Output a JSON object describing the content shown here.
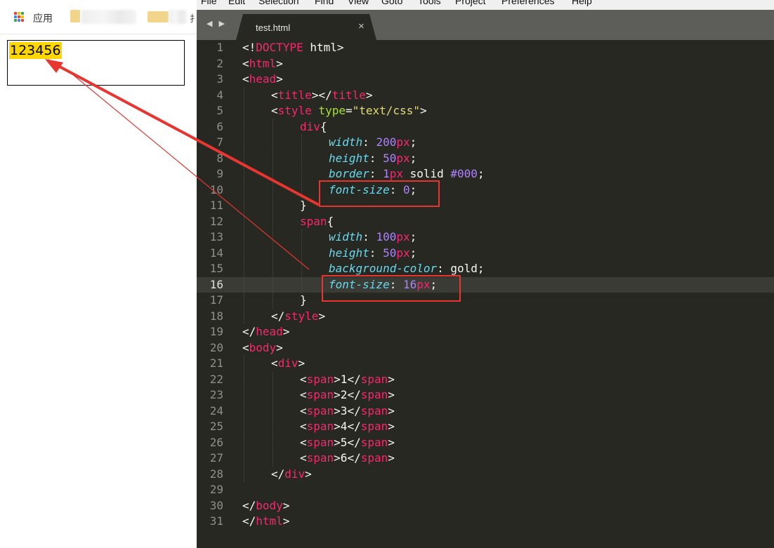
{
  "browser": {
    "bookmarks": {
      "apps_label": "应用",
      "more_glyph": "扌"
    },
    "demo_output": "123456"
  },
  "editor": {
    "menu": [
      "File",
      "Edit",
      "Selection",
      "Find",
      "View",
      "Goto",
      "Tools",
      "Project",
      "Preferences",
      "Help"
    ],
    "tab": {
      "title": "test.html",
      "close_glyph": "×",
      "nav_glyph": "◀ ▶"
    },
    "current_line": 16,
    "lines": [
      {
        "n": "1",
        "indent": 0,
        "tokens": [
          [
            "pun",
            "<!"
          ],
          [
            "tag",
            "DOCTYPE"
          ],
          [
            "pun",
            " html>"
          ]
        ]
      },
      {
        "n": "2",
        "indent": 0,
        "tokens": [
          [
            "pun",
            "<"
          ],
          [
            "tag",
            "html"
          ],
          [
            "pun",
            ">"
          ]
        ]
      },
      {
        "n": "3",
        "indent": 0,
        "tokens": [
          [
            "pun",
            "<"
          ],
          [
            "tag",
            "head"
          ],
          [
            "pun",
            ">"
          ]
        ]
      },
      {
        "n": "4",
        "indent": 1,
        "tokens": [
          [
            "pun",
            "<"
          ],
          [
            "tag",
            "title"
          ],
          [
            "pun",
            "></"
          ],
          [
            "tag",
            "title"
          ],
          [
            "pun",
            ">"
          ]
        ]
      },
      {
        "n": "5",
        "indent": 1,
        "tokens": [
          [
            "pun",
            "<"
          ],
          [
            "tag",
            "style"
          ],
          [
            "pun",
            " "
          ],
          [
            "attr",
            "type"
          ],
          [
            "pun",
            "="
          ],
          [
            "str",
            "\"text/css\""
          ],
          [
            "pun",
            ">"
          ]
        ]
      },
      {
        "n": "6",
        "indent": 2,
        "tokens": [
          [
            "tag",
            "div"
          ],
          [
            "pun",
            "{"
          ]
        ]
      },
      {
        "n": "7",
        "indent": 3,
        "tokens": [
          [
            "prop",
            "width"
          ],
          [
            "pun",
            ": "
          ],
          [
            "num",
            "200"
          ],
          [
            "tag",
            "px"
          ],
          [
            "pun",
            ";"
          ]
        ]
      },
      {
        "n": "8",
        "indent": 3,
        "tokens": [
          [
            "prop",
            "height"
          ],
          [
            "pun",
            ": "
          ],
          [
            "num",
            "50"
          ],
          [
            "tag",
            "px"
          ],
          [
            "pun",
            ";"
          ]
        ]
      },
      {
        "n": "9",
        "indent": 3,
        "tokens": [
          [
            "prop",
            "border"
          ],
          [
            "pun",
            ": "
          ],
          [
            "num",
            "1"
          ],
          [
            "tag",
            "px"
          ],
          [
            "pun",
            " solid "
          ],
          [
            "num",
            "#000"
          ],
          [
            "pun",
            ";"
          ]
        ]
      },
      {
        "n": "10",
        "indent": 3,
        "tokens": [
          [
            "prop",
            "font-size"
          ],
          [
            "pun",
            ": "
          ],
          [
            "num",
            "0"
          ],
          [
            "pun",
            ";"
          ]
        ]
      },
      {
        "n": "11",
        "indent": 2,
        "tokens": [
          [
            "pun",
            "}"
          ]
        ]
      },
      {
        "n": "12",
        "indent": 2,
        "tokens": [
          [
            "tag",
            "span"
          ],
          [
            "pun",
            "{"
          ]
        ]
      },
      {
        "n": "13",
        "indent": 3,
        "tokens": [
          [
            "prop",
            "width"
          ],
          [
            "pun",
            ": "
          ],
          [
            "num",
            "100"
          ],
          [
            "tag",
            "px"
          ],
          [
            "pun",
            ";"
          ]
        ]
      },
      {
        "n": "14",
        "indent": 3,
        "tokens": [
          [
            "prop",
            "height"
          ],
          [
            "pun",
            ": "
          ],
          [
            "num",
            "50"
          ],
          [
            "tag",
            "px"
          ],
          [
            "pun",
            ";"
          ]
        ]
      },
      {
        "n": "15",
        "indent": 3,
        "tokens": [
          [
            "prop",
            "background-color"
          ],
          [
            "pun",
            ": gold;"
          ]
        ]
      },
      {
        "n": "16",
        "indent": 3,
        "tokens": [
          [
            "prop",
            "font-size"
          ],
          [
            "pun",
            ": "
          ],
          [
            "num",
            "16"
          ],
          [
            "tag",
            "px"
          ],
          [
            "pun",
            ";"
          ]
        ]
      },
      {
        "n": "17",
        "indent": 2,
        "tokens": [
          [
            "pun",
            "}"
          ]
        ]
      },
      {
        "n": "18",
        "indent": 1,
        "tokens": [
          [
            "pun",
            "</"
          ],
          [
            "tag",
            "style"
          ],
          [
            "pun",
            ">"
          ]
        ]
      },
      {
        "n": "19",
        "indent": 0,
        "tokens": [
          [
            "pun",
            "</"
          ],
          [
            "tag",
            "head"
          ],
          [
            "pun",
            ">"
          ]
        ]
      },
      {
        "n": "20",
        "indent": 0,
        "tokens": [
          [
            "pun",
            "<"
          ],
          [
            "tag",
            "body"
          ],
          [
            "pun",
            ">"
          ]
        ]
      },
      {
        "n": "21",
        "indent": 1,
        "tokens": [
          [
            "pun",
            "<"
          ],
          [
            "tag",
            "div"
          ],
          [
            "pun",
            ">"
          ]
        ]
      },
      {
        "n": "22",
        "indent": 2,
        "tokens": [
          [
            "pun",
            "<"
          ],
          [
            "tag",
            "span"
          ],
          [
            "pun",
            ">1</"
          ],
          [
            "tag",
            "span"
          ],
          [
            "pun",
            ">"
          ]
        ]
      },
      {
        "n": "23",
        "indent": 2,
        "tokens": [
          [
            "pun",
            "<"
          ],
          [
            "tag",
            "span"
          ],
          [
            "pun",
            ">2</"
          ],
          [
            "tag",
            "span"
          ],
          [
            "pun",
            ">"
          ]
        ]
      },
      {
        "n": "24",
        "indent": 2,
        "tokens": [
          [
            "pun",
            "<"
          ],
          [
            "tag",
            "span"
          ],
          [
            "pun",
            ">3</"
          ],
          [
            "tag",
            "span"
          ],
          [
            "pun",
            ">"
          ]
        ]
      },
      {
        "n": "25",
        "indent": 2,
        "tokens": [
          [
            "pun",
            "<"
          ],
          [
            "tag",
            "span"
          ],
          [
            "pun",
            ">4</"
          ],
          [
            "tag",
            "span"
          ],
          [
            "pun",
            ">"
          ]
        ]
      },
      {
        "n": "26",
        "indent": 2,
        "tokens": [
          [
            "pun",
            "<"
          ],
          [
            "tag",
            "span"
          ],
          [
            "pun",
            ">5</"
          ],
          [
            "tag",
            "span"
          ],
          [
            "pun",
            ">"
          ]
        ]
      },
      {
        "n": "27",
        "indent": 2,
        "tokens": [
          [
            "pun",
            "<"
          ],
          [
            "tag",
            "span"
          ],
          [
            "pun",
            ">6</"
          ],
          [
            "tag",
            "span"
          ],
          [
            "pun",
            ">"
          ]
        ]
      },
      {
        "n": "28",
        "indent": 1,
        "tokens": [
          [
            "pun",
            "</"
          ],
          [
            "tag",
            "div"
          ],
          [
            "pun",
            ">"
          ]
        ]
      },
      {
        "n": "29",
        "indent": 0,
        "tokens": []
      },
      {
        "n": "30",
        "indent": 0,
        "tokens": [
          [
            "pun",
            "</"
          ],
          [
            "tag",
            "body"
          ],
          [
            "pun",
            ">"
          ]
        ]
      },
      {
        "n": "31",
        "indent": 0,
        "tokens": [
          [
            "pun",
            "</"
          ],
          [
            "tag",
            "html"
          ],
          [
            "pun",
            ">"
          ]
        ]
      }
    ]
  },
  "annotations": {
    "highlighted_lines": [
      10,
      16
    ],
    "arrow_color": "#e8352f"
  },
  "colors": {
    "editor_bg": "#272822",
    "tag": "#f92672",
    "attribute": "#a6e22e",
    "string": "#e6db74",
    "property": "#66d9ef",
    "number": "#ae81ff",
    "gold": "#ffd700"
  }
}
